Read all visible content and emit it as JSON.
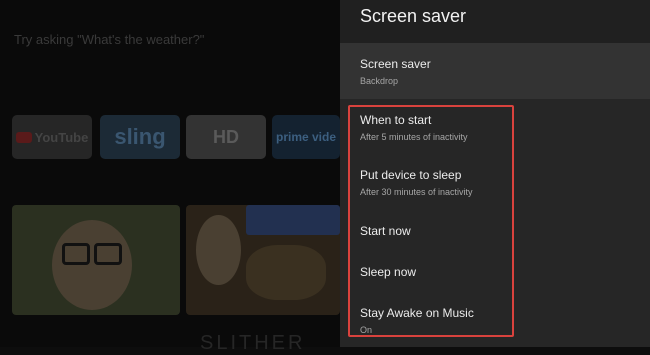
{
  "background": {
    "hint": "Try asking \"What's the weather?\"",
    "apps": [
      {
        "label": "YouTube",
        "icon": "youtube-icon"
      },
      {
        "label": "sling"
      },
      {
        "label": "HD"
      },
      {
        "label": "prime vide"
      }
    ],
    "bottom_text": "SLITHER"
  },
  "panel": {
    "title": "Screen saver",
    "items": [
      {
        "title": "Screen saver",
        "subtitle": "Backdrop"
      },
      {
        "title": "When to start",
        "subtitle": "After 5 minutes of inactivity"
      },
      {
        "title": "Put device to sleep",
        "subtitle": "After 30 minutes of inactivity"
      },
      {
        "title": "Start now"
      },
      {
        "title": "Sleep now"
      },
      {
        "title": "Stay Awake on Music",
        "subtitle": "On"
      }
    ]
  },
  "colors": {
    "highlight": "#d9423d",
    "panel": "#262626"
  }
}
